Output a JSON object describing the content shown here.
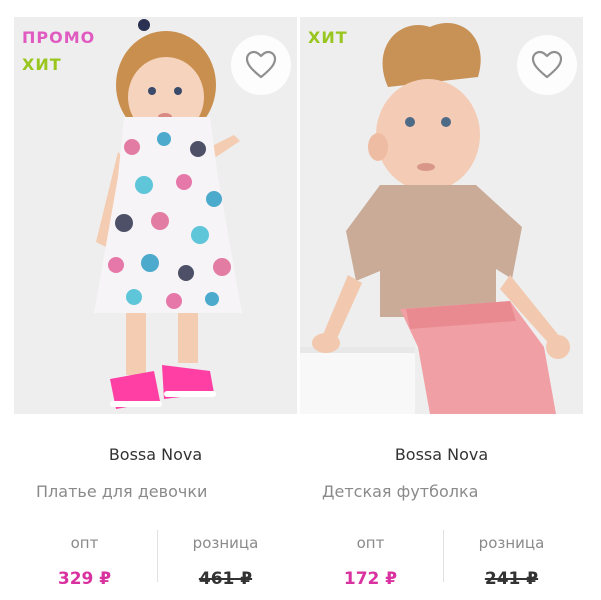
{
  "colors": {
    "promo": "#e05ac1",
    "hit": "#99c61e",
    "price_accent": "#d9319f"
  },
  "products": [
    {
      "badges": [
        "ПРОМО",
        "ХИТ"
      ],
      "favorite_icon": "heart-outline-icon",
      "brand": "Bossa Nova",
      "name": "Платье для девочки",
      "opt_label": "опт",
      "opt_price": "329 ₽",
      "retail_label": "розница",
      "retail_price": "461 ₽"
    },
    {
      "badges": [
        "ХИТ"
      ],
      "favorite_icon": "heart-outline-icon",
      "brand": "Bossa Nova",
      "name": "Детская футболка",
      "opt_label": "опт",
      "opt_price": "172 ₽",
      "retail_label": "розница",
      "retail_price": "241 ₽"
    }
  ]
}
